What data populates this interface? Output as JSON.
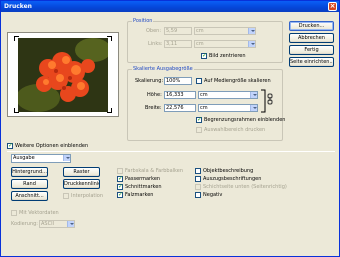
{
  "window": {
    "title": "Drucken",
    "close_glyph": "×"
  },
  "position": {
    "legend": "Position",
    "top_label": "Oben:",
    "top_value": "5,59",
    "top_unit": "cm",
    "left_label": "Links:",
    "left_value": "3,11",
    "left_unit": "cm",
    "center_label": "Bild zentrieren",
    "center_checked": true
  },
  "scaled": {
    "legend": "Skalierte Ausgabegröße",
    "scale_label": "Skalierung:",
    "scale_value": "100%",
    "fit_label": "Auf Mediengröße skalieren",
    "height_label": "Höhe:",
    "height_value": "16,333",
    "height_unit": "cm",
    "width_label": "Breite:",
    "width_value": "22,576",
    "width_unit": "cm",
    "bbox_label": "Begrenzungsrahmen einblenden",
    "bbox_checked": true,
    "selection_label": "Auswahlbereich drucken"
  },
  "buttons": {
    "print": "Drucken...",
    "cancel": "Abbrechen",
    "done": "Fertig",
    "page_setup": "Seite einrichten..."
  },
  "more_options": {
    "label": "Weitere Optionen einblenden",
    "checked": true
  },
  "output": {
    "dropdown_value": "Ausgabe",
    "background": "Hintergrund...",
    "border": "Rand",
    "bleed": "Anschnitt...",
    "screen": "Raster",
    "transfer": "Druckkennlinie",
    "interpolation": "Interpolation",
    "calibration_bars": "Farbskala & Farbbalken",
    "registration_marks": "Passermarken",
    "corner_crop_marks": "Schnittmarken",
    "center_crop_marks": "Falzmarken",
    "description": "Objektbeschreibung",
    "labels": "Auszugsbeschriftungen",
    "emulsion_down": "Schichtseite unten (Seitenrichtig)",
    "negative": "Negativ",
    "include_vector": "Mit Vektordaten",
    "encoding_label": "Kodierung:",
    "encoding_value": "ASCII"
  },
  "icons": {
    "link": "chain-link-icon"
  }
}
